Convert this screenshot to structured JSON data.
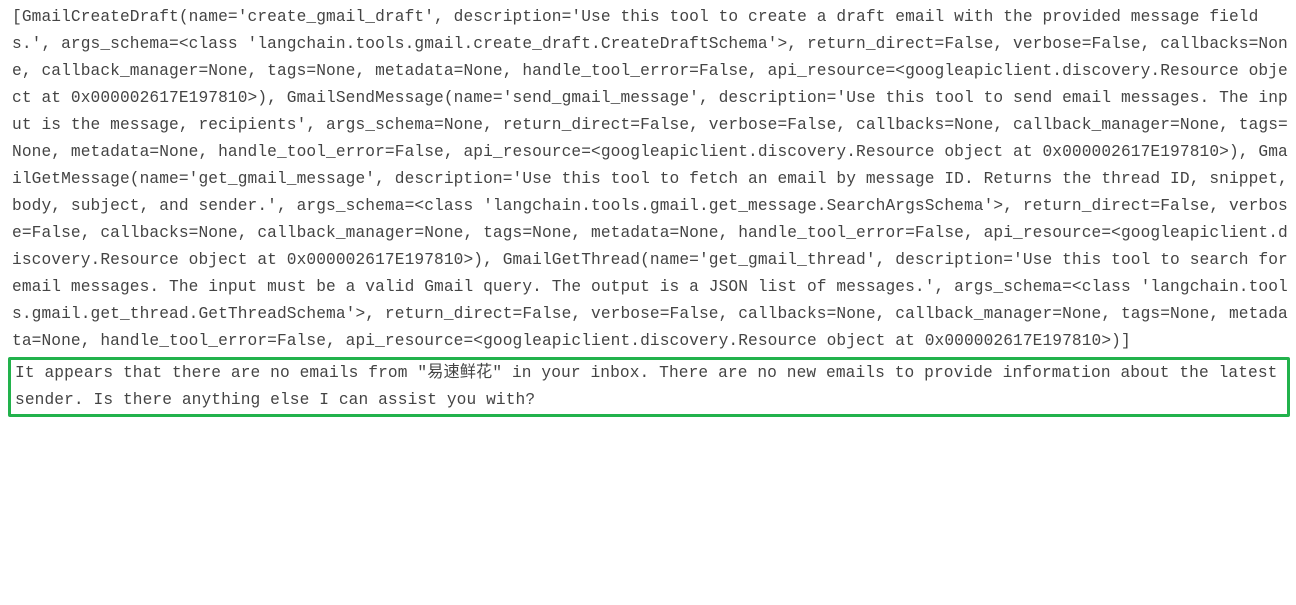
{
  "output_block": "[GmailCreateDraft(name='create_gmail_draft', description='Use this tool to create a draft email with the provided message fields.', args_schema=<class 'langchain.tools.gmail.create_draft.CreateDraftSchema'>, return_direct=False, verbose=False, callbacks=None, callback_manager=None, tags=None, metadata=None, handle_tool_error=False, api_resource=<googleapiclient.discovery.Resource object at 0x000002617E197810>), GmailSendMessage(name='send_gmail_message', description='Use this tool to send email messages. The input is the message, recipients', args_schema=None, return_direct=False, verbose=False, callbacks=None, callback_manager=None, tags=None, metadata=None, handle_tool_error=False, api_resource=<googleapiclient.discovery.Resource object at 0x000002617E197810>), GmailGetMessage(name='get_gmail_message', description='Use this tool to fetch an email by message ID. Returns the thread ID, snippet, body, subject, and sender.', args_schema=<class 'langchain.tools.gmail.get_message.SearchArgsSchema'>, return_direct=False, verbose=False, callbacks=None, callback_manager=None, tags=None, metadata=None, handle_tool_error=False, api_resource=<googleapiclient.discovery.Resource object at 0x000002617E197810>), GmailGetThread(name='get_gmail_thread', description='Use this tool to search for email messages. The input must be a valid Gmail query. The output is a JSON list of messages.', args_schema=<class 'langchain.tools.gmail.get_thread.GetThreadSchema'>, return_direct=False, verbose=False, callbacks=None, callback_manager=None, tags=None, metadata=None, handle_tool_error=False, api_resource=<googleapiclient.discovery.Resource object at 0x000002617E197810>)]",
  "response_block": "It appears that there are no emails from \"易速鲜花\" in your inbox. There are no new emails to provide information about the latest sender. Is there anything else I can assist you with?"
}
